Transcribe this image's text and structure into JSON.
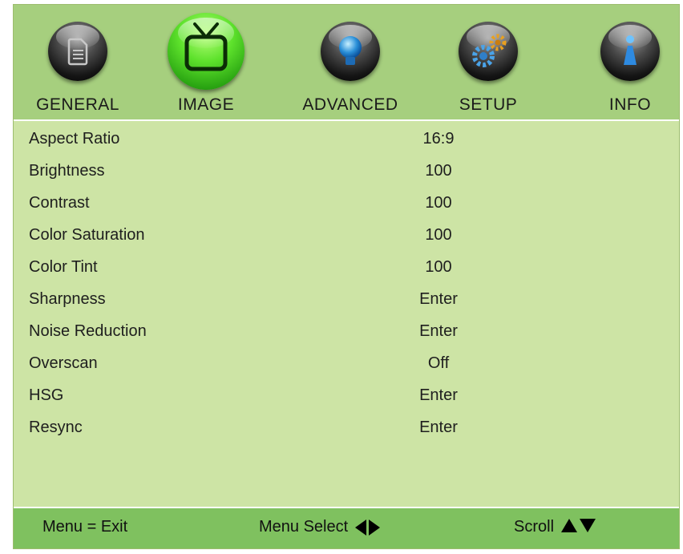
{
  "tabs": [
    {
      "label": "GENERAL",
      "icon": "document-icon",
      "active": false
    },
    {
      "label": "IMAGE",
      "icon": "tv-icon",
      "active": true
    },
    {
      "label": "ADVANCED",
      "icon": "lightbulb-icon",
      "active": false
    },
    {
      "label": "SETUP",
      "icon": "gears-icon",
      "active": false
    },
    {
      "label": "INFO",
      "icon": "info-icon",
      "active": false
    }
  ],
  "settings": [
    {
      "name": "Aspect Ratio",
      "value": "16:9"
    },
    {
      "name": "Brightness",
      "value": "100"
    },
    {
      "name": "Contrast",
      "value": "100"
    },
    {
      "name": "Color Saturation",
      "value": "100"
    },
    {
      "name": "Color Tint",
      "value": "100"
    },
    {
      "name": "Sharpness",
      "value": "Enter"
    },
    {
      "name": "Noise Reduction",
      "value": "Enter"
    },
    {
      "name": "Overscan",
      "value": "Off"
    },
    {
      "name": "HSG",
      "value": "Enter"
    },
    {
      "name": "Resync",
      "value": "Enter"
    }
  ],
  "footer": {
    "exit_hint": "Menu = Exit",
    "select_hint": "Menu Select",
    "scroll_hint": "Scroll"
  },
  "colors": {
    "panel": "#cde4a5",
    "tab_bar": "#a6cf7e",
    "footer": "#7fc15f",
    "active_orb": "#4ed01f"
  }
}
